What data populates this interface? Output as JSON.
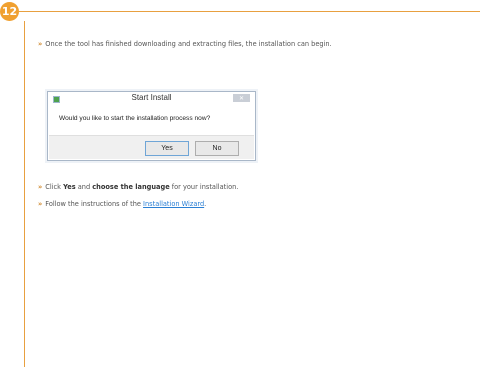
{
  "step": {
    "number": "12"
  },
  "intro": {
    "marker": "»",
    "text": "Once the tool has finished downloading and extracting files, the installation can begin."
  },
  "dialog": {
    "title": "Start Install",
    "close_symbol": "✕",
    "question": "Would you like to start the installation process now?",
    "yes_label": "Yes",
    "no_label": "No"
  },
  "bullets": [
    {
      "marker": "»",
      "part1": "Click ",
      "bold1": "Yes",
      "part2": " and ",
      "bold2": "choose the language",
      "part3": " for your installation."
    },
    {
      "marker": "»",
      "part1": "Follow the instructions of the ",
      "link": "Installation Wizard",
      "part2": "."
    }
  ],
  "colors": {
    "accent": "#f0a030",
    "rule": "#e8a040",
    "link": "#2a7fd4"
  }
}
